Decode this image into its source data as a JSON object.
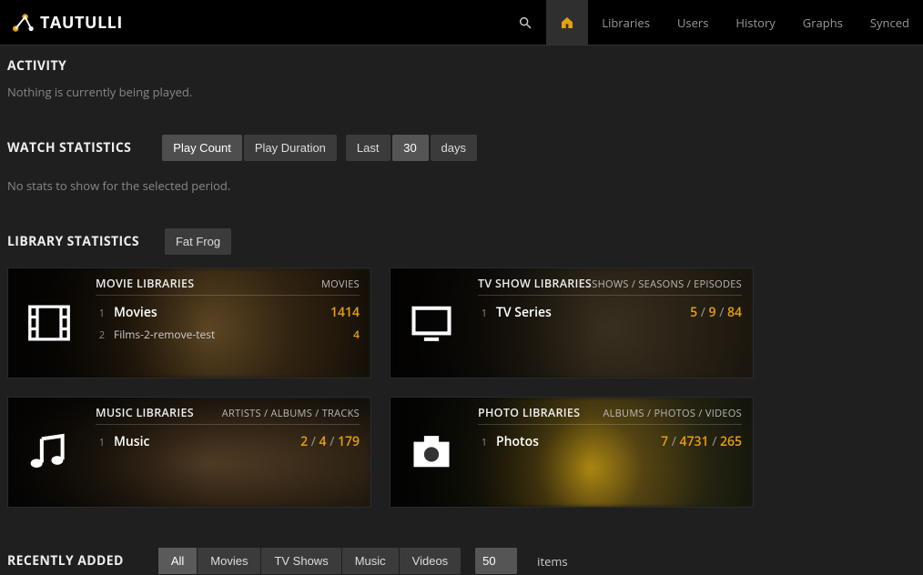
{
  "brand": {
    "name": "TAUTULLI"
  },
  "nav": {
    "libraries": "Libraries",
    "users": "Users",
    "history": "History",
    "graphs": "Graphs",
    "synced": "Synced"
  },
  "activity": {
    "heading": "ACTIVITY",
    "empty": "Nothing is currently being played."
  },
  "watch_stats": {
    "heading": "WATCH STATISTICS",
    "play_count": "Play Count",
    "play_duration": "Play Duration",
    "last": "Last",
    "period_value": "30",
    "period_unit": "days",
    "empty": "No stats to show for the selected period."
  },
  "library_stats": {
    "heading": "LIBRARY STATISTICS",
    "server_name": "Fat Frog",
    "cards": {
      "movies": {
        "title": "MOVIE LIBRARIES",
        "meta": "MOVIES",
        "rows": [
          {
            "idx": "1",
            "name": "Movies",
            "value": "1414"
          },
          {
            "idx": "2",
            "name": "Films-2-remove-test",
            "value": "4"
          }
        ]
      },
      "tv": {
        "title": "TV SHOW LIBRARIES",
        "meta": "SHOWS / SEASONS / EPISODES",
        "rows": [
          {
            "idx": "1",
            "name": "TV Series",
            "v1": "5",
            "v2": "9",
            "v3": "84"
          }
        ]
      },
      "music": {
        "title": "MUSIC LIBRARIES",
        "meta": "ARTISTS / ALBUMS / TRACKS",
        "rows": [
          {
            "idx": "1",
            "name": "Music",
            "v1": "2",
            "v2": "4",
            "v3": "179"
          }
        ]
      },
      "photos": {
        "title": "PHOTO LIBRARIES",
        "meta": "ALBUMS / PHOTOS / VIDEOS",
        "rows": [
          {
            "idx": "1",
            "name": "Photos",
            "v1": "7",
            "v2": "4731",
            "v3": "265"
          }
        ]
      }
    }
  },
  "recently_added": {
    "heading": "RECENTLY ADDED",
    "tabs": {
      "all": "All",
      "movies": "Movies",
      "tv": "TV Shows",
      "music": "Music",
      "videos": "Videos"
    },
    "count_value": "50",
    "items_label": "items"
  }
}
